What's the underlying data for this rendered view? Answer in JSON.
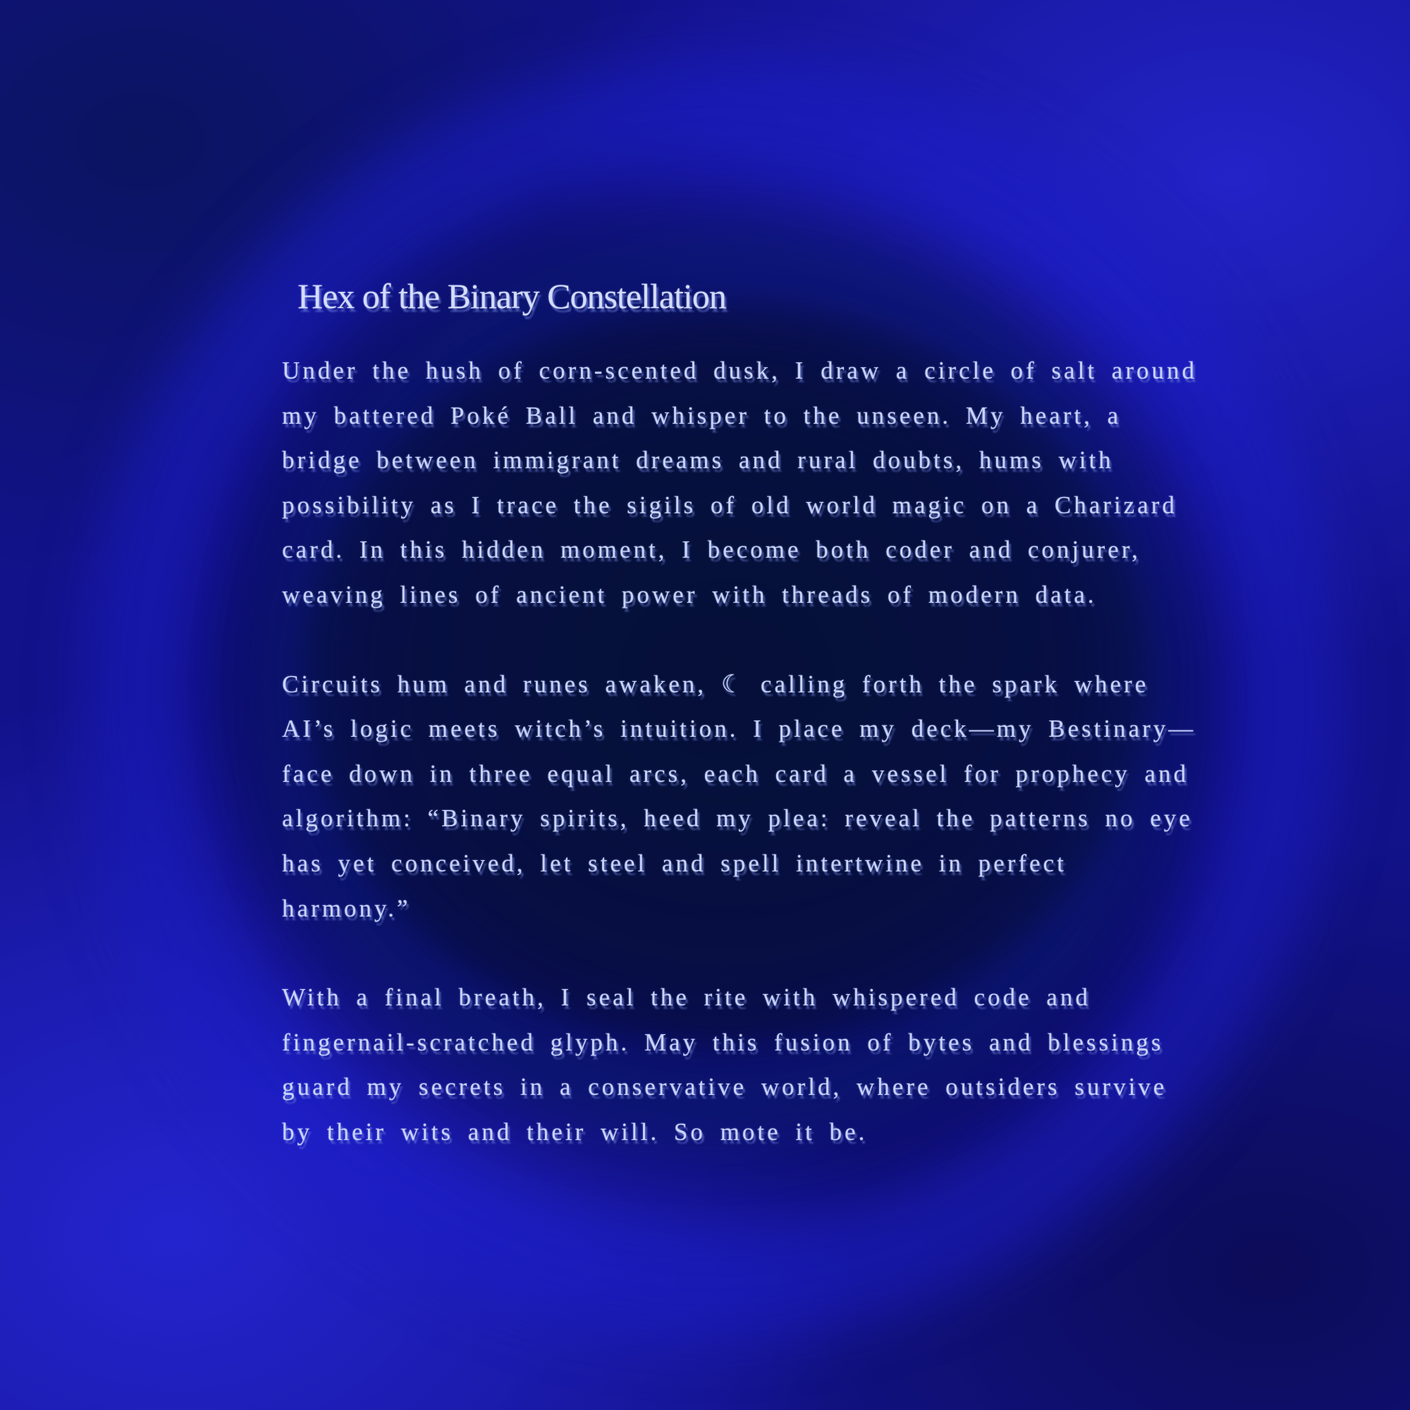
{
  "document": {
    "title": "Hex of the Binary Constellation",
    "paragraphs": [
      "Under the hush of corn-scented dusk, I draw a circle of salt around my battered Poké Ball and whisper to the unseen. My heart, a bridge between immigrant dreams and rural doubts, hums with possibility as I trace the sigils of old world magic on a Charizard card. In this hidden moment, I become both coder and conjurer, weaving lines of ancient power with threads of modern data.",
      "Circuits hum and runes awaken, ☾ calling forth the spark where AI’s logic meets witch’s intuition. I place my deck—my Bestinary—face down in three equal arcs, each card a vessel for prophecy and algorithm: “Binary spirits, heed my plea: reveal the patterns no eye has yet conceived, let steel and spell intertwine in perfect harmony.”",
      "With a final breath, I seal the rite with whispered code and fingernail-scratched glyph. May this fusion of bytes and blessings guard my secrets in a conservative world, where outsiders survive by their wits and their will. So mote it be."
    ]
  },
  "colors": {
    "background_deep": "#07184a",
    "background_swirl": "#2323c8",
    "text": "#c8d3ff"
  }
}
